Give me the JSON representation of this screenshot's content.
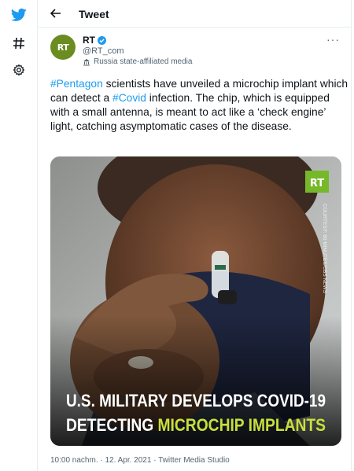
{
  "header": {
    "title": "Tweet"
  },
  "tweet": {
    "author_name": "RT",
    "author_handle": "@RT_com",
    "avatar_text": "RT",
    "account_label": "Russia state-affiliated media",
    "text": {
      "hashtag1": "#Pentagon",
      "part1": " scientists have unveiled a microchip implant which can detect a ",
      "hashtag2": "#Covid",
      "part2": " infection. The chip, which is equipped with a small antenna, is meant to act like a ‘check engine’ light, catching asymptomatic cases of the disease."
    },
    "media": {
      "headline_line1": "U.S. MILITARY DEVELOPS COVID-19",
      "headline_line2a": "DETECTING ",
      "headline_line2b": "MICROCHIP IMPLANTS",
      "logo_text": "RT",
      "courtesy": "COURTESY: 60 MINUTES/CBS NEWS"
    },
    "timestamp": "10:00 nachm. · 12. Apr. 2021 · Twitter Media Studio"
  },
  "colors": {
    "accent": "#1d9bf0",
    "headline_yellow": "#c8e03c",
    "rt_green": "#6b8c21"
  },
  "icons": [
    "twitter-bird-icon",
    "hashtag-icon",
    "gear-icon",
    "back-arrow-icon",
    "verified-badge-icon",
    "more-options-icon",
    "state-media-icon"
  ]
}
